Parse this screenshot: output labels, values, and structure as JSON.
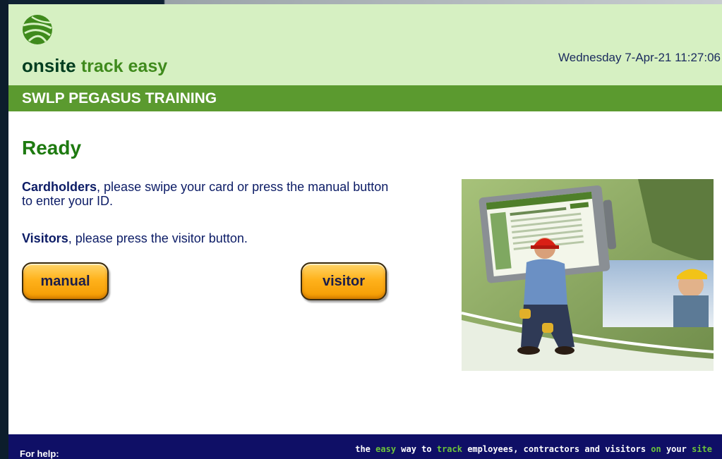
{
  "header": {
    "brand_primary": "onsite",
    "brand_secondary": "track easy",
    "datetime": "Wednesday 7-Apr-21 11:27:06",
    "logo_icon": "globe-logo-icon"
  },
  "banner": {
    "site_name": "SWLP PEGASUS TRAINING"
  },
  "main": {
    "status": "Ready",
    "cardholders_label": "Cardholders",
    "cardholders_text": ", please swipe your card or press the manual button to enter your ID.",
    "visitors_label": "Visitors",
    "visitors_text": ", please press the visitor button.",
    "manual_button": "manual",
    "visitor_button": "visitor"
  },
  "footer": {
    "help_label": "For help:",
    "tagline": {
      "t1": "the ",
      "h1": "easy",
      "t2": " way to ",
      "h2": "track",
      "t3": " employees, contractors and visitors ",
      "h3": "on",
      "t4": " your ",
      "h4": "site"
    }
  },
  "colors": {
    "header_bg": "#d6f0c2",
    "banner_bg": "#5b9a2f",
    "status_green": "#1e7a10",
    "text_navy": "#0c1c66",
    "button_orange": "#ffb21c",
    "footer_bg": "#0f0f66",
    "tagline_highlight": "#6cc33a"
  }
}
